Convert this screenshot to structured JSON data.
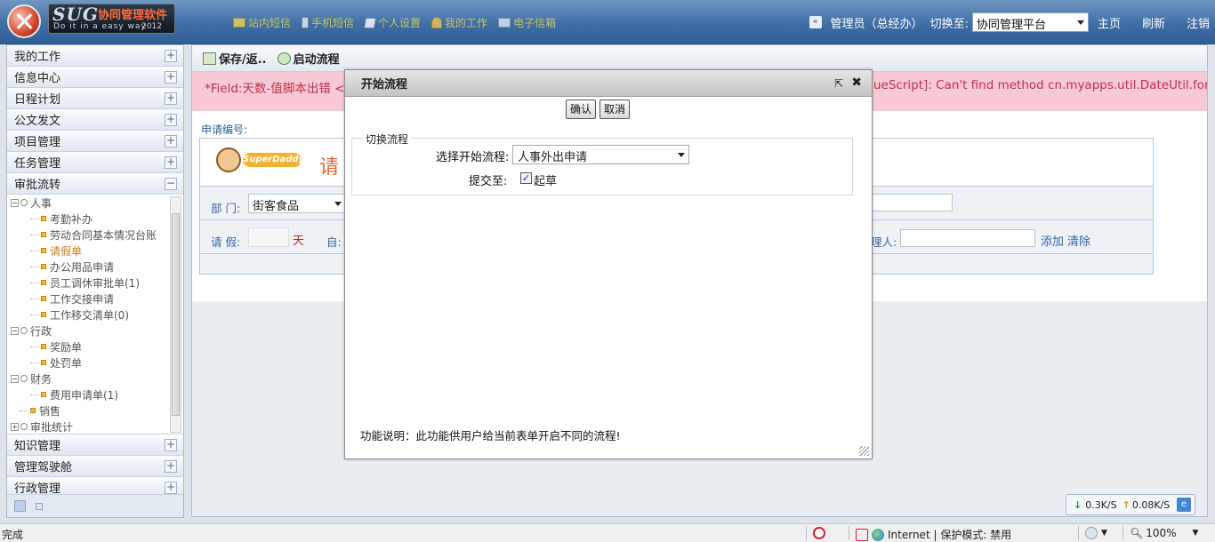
{
  "header": {
    "logo_sug": "SUG",
    "logo_cn": "协同管理软件",
    "logo_sub": "Do it in a  easy way",
    "logo_year": "2012",
    "nav": [
      "站内短信",
      "手机短信",
      "个人设置",
      "我的工作",
      "电子信箱"
    ],
    "user": "管理员（总经办）",
    "switch_label": "切换至:",
    "platform": "协同管理平台",
    "links": [
      "主页",
      "刷新",
      "注销"
    ]
  },
  "sidebar": {
    "menus_top": [
      "我的工作",
      "信息中心",
      "日程计划",
      "公文发文",
      "项目管理",
      "任务管理"
    ],
    "approval": "审批流转",
    "tree": [
      {
        "label": "人事",
        "type": "folder",
        "level": 0
      },
      {
        "label": "考勤补办",
        "type": "leaf",
        "level": 1
      },
      {
        "label": "劳动合同基本情况台账",
        "type": "leaf",
        "level": 1
      },
      {
        "label": "请假单",
        "type": "leaf",
        "level": 1
      },
      {
        "label": "办公用品申请",
        "type": "leaf",
        "level": 1
      },
      {
        "label": "员工调休审批单(1)",
        "type": "leaf",
        "level": 1
      },
      {
        "label": "工作交接申请",
        "type": "leaf",
        "level": 1
      },
      {
        "label": "工作移交清单(0)",
        "type": "leaf",
        "level": 1
      },
      {
        "label": "行政",
        "type": "folder",
        "level": 0
      },
      {
        "label": "奖励单",
        "type": "leaf",
        "level": 1
      },
      {
        "label": "处罚单",
        "type": "leaf",
        "level": 1
      },
      {
        "label": "财务",
        "type": "folder",
        "level": 0
      },
      {
        "label": "费用申请单(1)",
        "type": "leaf",
        "level": 1
      },
      {
        "label": "销售",
        "type": "leaf",
        "level": 0
      },
      {
        "label": "审批统计",
        "type": "folder",
        "level": 0
      }
    ],
    "menus_bottom": [
      "知识管理",
      "管理驾驶舱",
      "行政管理"
    ]
  },
  "toolbar": {
    "save_label": "保存/返..",
    "start_flow_label": "启动流程"
  },
  "error": {
    "left": "*Field:天数-值脚本出错 <",
    "right": "ueScript]: Can't find method cn.myapps.util.DateUtil.format"
  },
  "form": {
    "apply_no": "申请编号:",
    "logo_text": "SuperDaddy",
    "title": "请",
    "dept_label": "部 门:",
    "dept_value": "街客食品",
    "leave_label": "请 假:",
    "days_unit": "天",
    "from_label": "自:",
    "agent_label": "理人:",
    "add": "添加",
    "clear": "清除"
  },
  "modal": {
    "title": "开始流程",
    "confirm": "确认",
    "cancel": "取消",
    "legend": "切换流程",
    "select_label": "选择开始流程:",
    "select_value": "人事外出申请",
    "submit_label": "提交至:",
    "check_mark": "✓",
    "check_label": "起草",
    "desc": "功能说明：此功能供用户给当前表单开启不同的流程!"
  },
  "speed": {
    "down": "0.3K/S",
    "up": "0.08K/S"
  },
  "statusbar": {
    "text": "完成",
    "zone": "Internet | 保护模式: 禁用",
    "zoom": "100%"
  }
}
